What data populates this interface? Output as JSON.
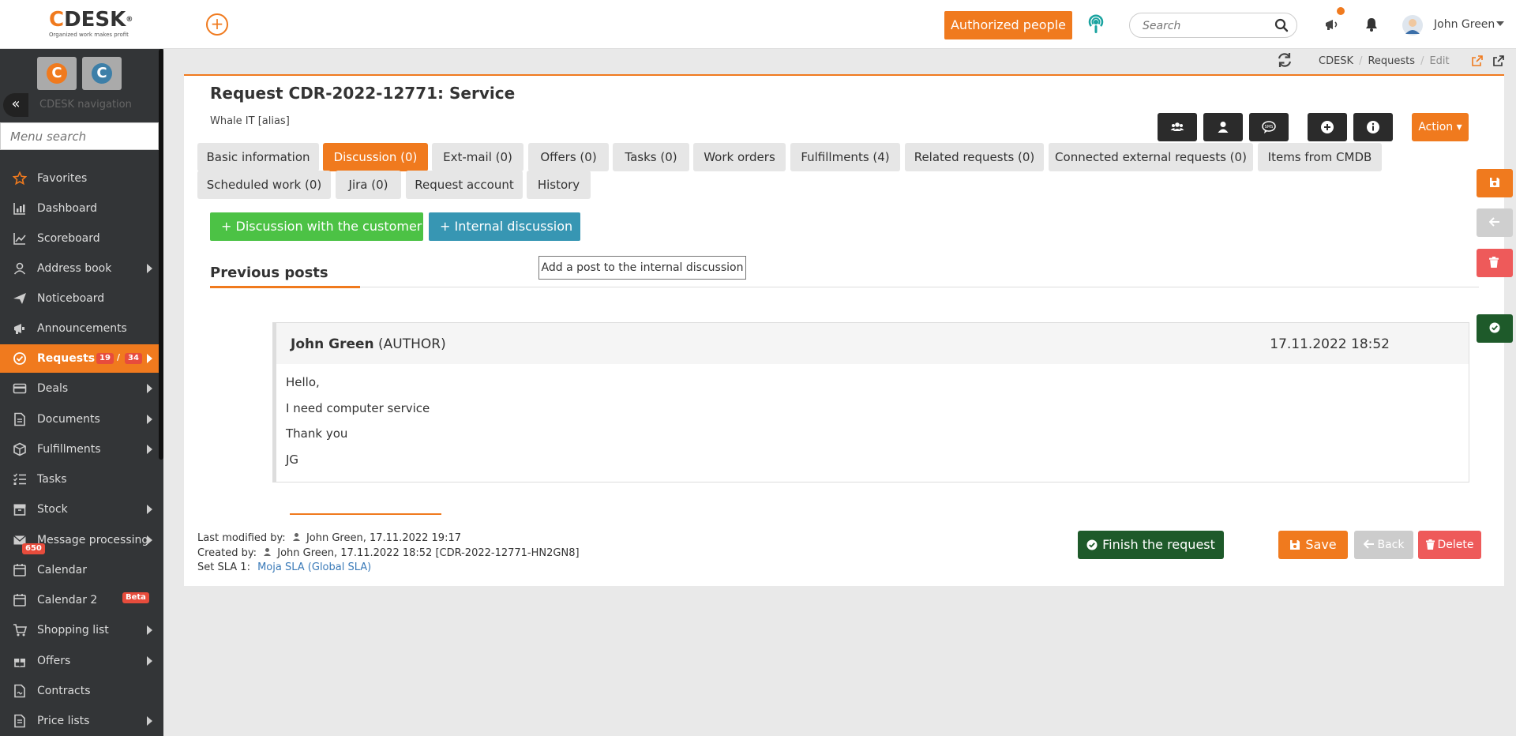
{
  "header": {
    "logo_text": "DESK",
    "logo_c": "C",
    "logo_reg": "®",
    "logo_tagline": "Organized work makes profit",
    "add_symbol": "+",
    "authorized_label": "Authorized people",
    "search_placeholder": "Search",
    "user_name": "John Green"
  },
  "sidebar": {
    "nav_title": "CDESK navigation",
    "collapse_symbol": "«",
    "app1": "C",
    "app2": "C",
    "menu_search_placeholder": "Menu search",
    "items": [
      {
        "label": "Favorites",
        "icon": "star-icon"
      },
      {
        "label": "Dashboard",
        "icon": "dashboard-icon"
      },
      {
        "label": "Scoreboard",
        "icon": "chart-line-icon"
      },
      {
        "label": "Address book",
        "icon": "user-icon"
      },
      {
        "label": "Noticeboard",
        "icon": "paper-plane-icon"
      },
      {
        "label": "Announcements",
        "icon": "megaphone-icon"
      },
      {
        "label": "Requests",
        "icon": "requests-icon",
        "badge1": "19",
        "badge_sep": "/",
        "badge2": "34"
      },
      {
        "label": "Deals",
        "icon": "card-icon"
      },
      {
        "label": "Documents",
        "icon": "document-icon"
      },
      {
        "label": "Fulfillments",
        "icon": "box-icon"
      },
      {
        "label": "Tasks",
        "icon": "tasks-icon"
      },
      {
        "label": "Stock",
        "icon": "archive-icon"
      },
      {
        "label": "Message processing",
        "icon": "envelope-icon",
        "badge": "650"
      },
      {
        "label": "Calendar",
        "icon": "calendar-icon"
      },
      {
        "label": "Calendar 2",
        "icon": "calendar-icon",
        "badge": "Beta"
      },
      {
        "label": "Shopping list",
        "icon": "cart-icon"
      },
      {
        "label": "Offers",
        "icon": "gift-icon"
      },
      {
        "label": "Contracts",
        "icon": "contract-icon"
      },
      {
        "label": "Price lists",
        "icon": "price-list-icon"
      }
    ]
  },
  "breadcrumb": {
    "items": [
      "CDESK",
      "Requests",
      "Edit"
    ],
    "sep": "/"
  },
  "request": {
    "title": "Request CDR-2022-12771: Service",
    "subtitle": "Whale IT [alias]",
    "action_label": "Action ▾"
  },
  "tabs": [
    {
      "label": "Basic information"
    },
    {
      "label": "Discussion (0)",
      "active": true
    },
    {
      "label": "Ext-mail (0)"
    },
    {
      "label": "Offers (0)"
    },
    {
      "label": "Tasks (0)"
    },
    {
      "label": "Work orders"
    },
    {
      "label": "Fulfillments (4)"
    },
    {
      "label": "Related requests (0)"
    },
    {
      "label": "Connected external requests (0)"
    },
    {
      "label": "Items from CMDB"
    },
    {
      "label": "Scheduled work (0)"
    },
    {
      "label": "Jira (0)"
    },
    {
      "label": "Request account"
    },
    {
      "label": "History"
    }
  ],
  "discussion": {
    "customer_btn": "+  Discussion with the customer",
    "internal_btn": "+  Internal discussion",
    "tooltip": "Add a post to the internal discussion",
    "previous_title": "Previous posts"
  },
  "post": {
    "author": "John Green",
    "role": "(AUTHOR)",
    "date": "17.11.2022 18:52",
    "lines": [
      "Hello,",
      "I need computer service",
      "Thank you",
      "JG"
    ]
  },
  "meta": {
    "modified_label": "Last modified by:",
    "modified_value": "John Green,  17.11.2022 19:17",
    "created_label": "Created by:",
    "created_value": "John Green,  17.11.2022 18:52 [CDR-2022-12771-HN2GN8]",
    "sla_label": "Set SLA 1:",
    "sla_value": "Moja SLA (Global SLA)"
  },
  "footer_buttons": {
    "finish": "Finish the request",
    "save": "Save",
    "back": "Back",
    "delete": "Delete"
  },
  "colors": {
    "accent": "#f07a1e",
    "sidebar_bg": "#333537",
    "customer_green": "#4cc245",
    "internal_blue": "#3796b3",
    "finish_green": "#1e5a2a",
    "danger": "#ee5a5a"
  }
}
